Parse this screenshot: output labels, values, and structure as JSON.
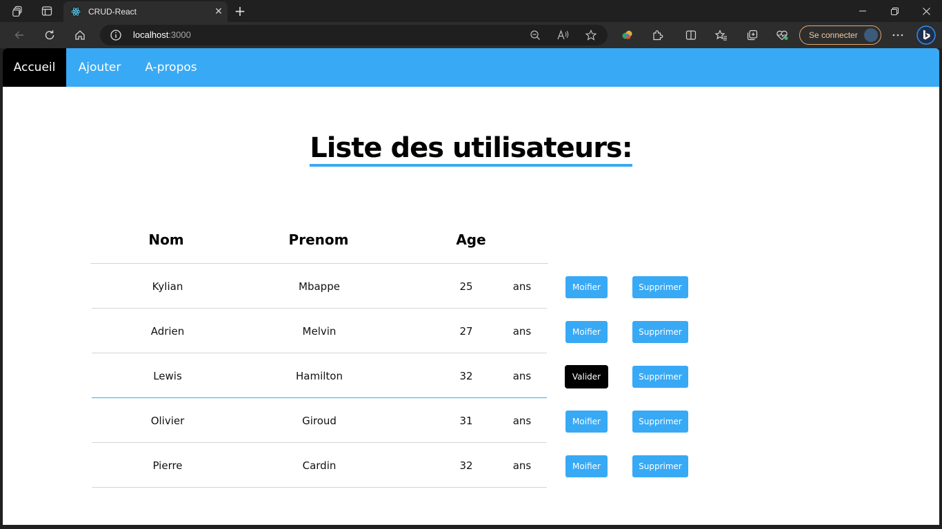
{
  "browser": {
    "tab_title": "CRUD-React",
    "address_host": "localhost",
    "address_port": ":3000",
    "signin_label": "Se connecter"
  },
  "nav": {
    "items": [
      {
        "label": "Accueil",
        "active": true
      },
      {
        "label": "Ajouter",
        "active": false
      },
      {
        "label": "A-propos",
        "active": false
      }
    ]
  },
  "page": {
    "title": "Liste des utilisateurs:"
  },
  "table": {
    "headers": {
      "nom": "Nom",
      "prenom": "Prenom",
      "age": "Age"
    },
    "age_unit": "ans",
    "rows": [
      {
        "nom": "Kylian",
        "prenom": "Mbappe",
        "age": "25",
        "edit_label": "Moifier",
        "delete_label": "Supprimer"
      },
      {
        "nom": "Adrien",
        "prenom": "Melvin",
        "age": "27",
        "edit_label": "Moifier",
        "delete_label": "Supprimer"
      },
      {
        "nom": "Lewis",
        "prenom": "Hamilton",
        "age": "32",
        "edit_label": "Valider",
        "delete_label": "Supprimer"
      },
      {
        "nom": "Olivier",
        "prenom": "Giroud",
        "age": "31",
        "edit_label": "Moifier",
        "delete_label": "Supprimer"
      },
      {
        "nom": "Pierre",
        "prenom": "Cardin",
        "age": "32",
        "edit_label": "Moifier",
        "delete_label": "Supprimer"
      }
    ]
  },
  "colors": {
    "accent": "#38a9f5",
    "active_nav": "#000000",
    "validate_button": "#000000"
  }
}
